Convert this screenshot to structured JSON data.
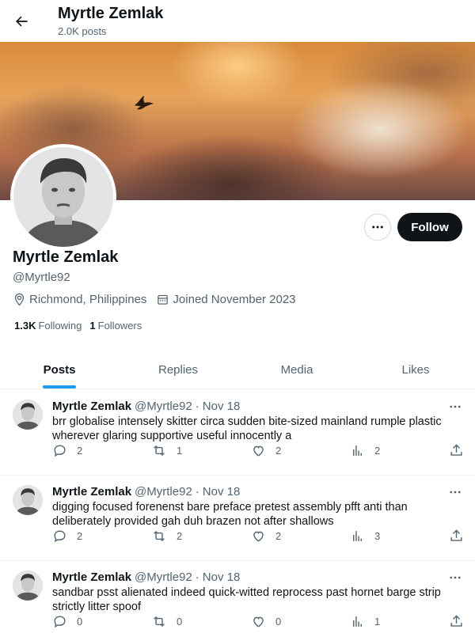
{
  "header": {
    "title": "Myrtle Zemlak",
    "post_count": "2.0K posts",
    "back_icon": "arrow-left-icon"
  },
  "profile": {
    "name": "Myrtle Zemlak",
    "handle": "@Myrtle92",
    "location": "Richmond, Philippines",
    "joined": "Joined November 2023",
    "following_count": "1.3K",
    "following_label": "Following",
    "followers_count": "1",
    "followers_label": "Followers",
    "follow_label": "Follow"
  },
  "tabs": [
    {
      "label": "Posts",
      "active": true
    },
    {
      "label": "Replies"
    },
    {
      "label": "Media"
    },
    {
      "label": "Likes"
    }
  ],
  "posts": [
    {
      "name": "Myrtle Zemlak",
      "handle": "@Myrtle92",
      "dot": "·",
      "time": "Nov 18",
      "text": "brr globalise intensely skitter circa sudden bite-sized mainland rumple plastic wherever glaring supportive useful innocently a",
      "replies": "2",
      "reposts": "1",
      "likes": "2",
      "views": "2"
    },
    {
      "name": "Myrtle Zemlak",
      "handle": "@Myrtle92",
      "dot": "·",
      "time": "Nov 18",
      "text": "digging focused forenenst bare preface pretest assembly pfft anti than deliberately provided gah duh brazen not after shallows",
      "replies": "2",
      "reposts": "2",
      "likes": "2",
      "views": "3"
    },
    {
      "name": "Myrtle Zemlak",
      "handle": "@Myrtle92",
      "dot": "·",
      "time": "Nov 18",
      "text": "sandbar psst alienated indeed quick-witted reprocess past hornet barge strip strictly litter spoof",
      "replies": "0",
      "reposts": "0",
      "likes": "0",
      "views": "1"
    }
  ],
  "colors": {
    "accent": "#1d9bf0",
    "text": "#0f1419",
    "muted": "#536471",
    "border": "#eff3f4"
  }
}
